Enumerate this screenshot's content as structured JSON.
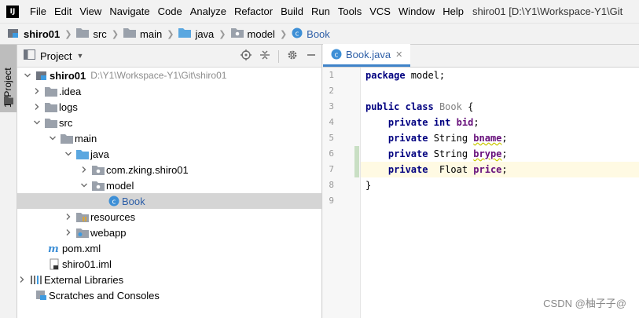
{
  "menubar": {
    "logo": "IJ",
    "items": [
      "File",
      "Edit",
      "View",
      "Navigate",
      "Code",
      "Analyze",
      "Refactor",
      "Build",
      "Run",
      "Tools",
      "VCS",
      "Window",
      "Help"
    ],
    "window_title": "shiro01 [D:\\Y1\\Workspace-Y1\\Git"
  },
  "breadcrumbs": [
    "shiro01",
    "src",
    "main",
    "java",
    "model",
    "Book"
  ],
  "stripe": {
    "label": "1: Project"
  },
  "project_panel": {
    "title": "Project",
    "tree": [
      {
        "label": "shiro01",
        "path": "D:\\Y1\\Workspace-Y1\\Git\\shiro01"
      },
      {
        "label": ".idea"
      },
      {
        "label": "logs"
      },
      {
        "label": "src"
      },
      {
        "label": "main"
      },
      {
        "label": "java"
      },
      {
        "label": "com.zking.shiro01"
      },
      {
        "label": "model"
      },
      {
        "label": "Book"
      },
      {
        "label": "resources"
      },
      {
        "label": "webapp"
      },
      {
        "label": "pom.xml"
      },
      {
        "label": "shiro01.iml"
      },
      {
        "label": "External Libraries"
      },
      {
        "label": "Scratches and Consoles"
      }
    ]
  },
  "editor": {
    "tab_label": "Book.java",
    "line_numbers": [
      "1",
      "2",
      "3",
      "4",
      "5",
      "6",
      "7",
      "8",
      "9"
    ],
    "code": {
      "l1_kw": "package",
      "l1_rest": " model;",
      "l3_kw1": "public",
      "l3_kw2": "class",
      "l3_name": "Book",
      "l3_rest": " {",
      "l4_kw": "private",
      "l4_type": "int",
      "l4_field": "bid",
      "l4_end": ";",
      "l5_kw": "private",
      "l5_type": " String ",
      "l5_field": "bname",
      "l5_end": ";",
      "l6_kw": "private",
      "l6_type": " String ",
      "l6_field": "brype",
      "l6_end": ";",
      "l7_kw": "private",
      "l7_type": "  Float ",
      "l7_field": "price",
      "l7_end": ";",
      "l8": "}"
    }
  },
  "watermark": "CSDN @柚子子@"
}
